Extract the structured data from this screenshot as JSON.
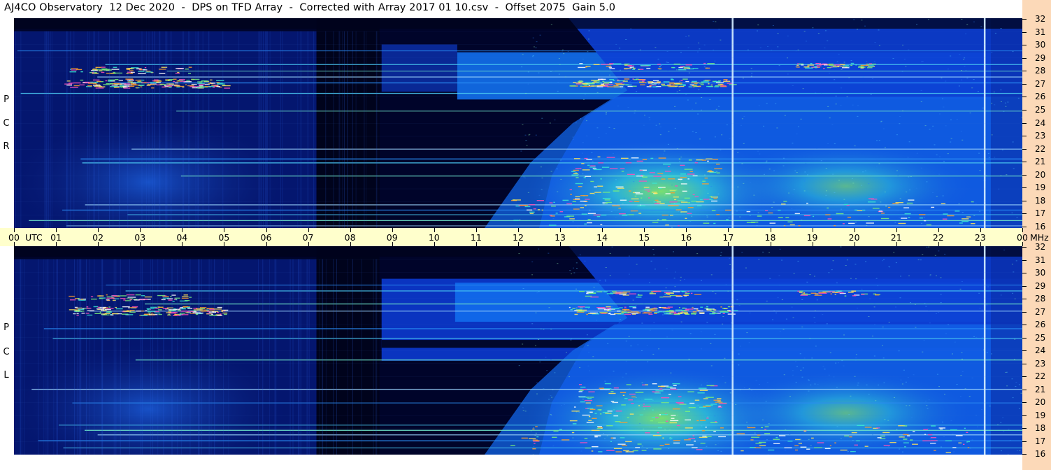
{
  "title": "AJ4CO Observatory  12 Dec 2020  -  DPS on TFD Array  -  Corrected with Array 2017 01 10.csv  -  Offset 2075  Gain 5.0",
  "panels": [
    {
      "id": "rcp",
      "label_letters": [
        "P",
        "C",
        "R"
      ]
    },
    {
      "id": "lcp",
      "label_letters": [
        "P",
        "C",
        "L"
      ]
    }
  ],
  "time_axis": {
    "labels": [
      "00",
      "01",
      "02",
      "03",
      "04",
      "05",
      "06",
      "07",
      "08",
      "09",
      "10",
      "11",
      "12",
      "13",
      "14",
      "15",
      "16",
      "17",
      "18",
      "19",
      "20",
      "21",
      "22",
      "23",
      "00"
    ],
    "unit_left": "UTC",
    "unit_right": "MHz"
  },
  "freq_axis": {
    "labels": [
      "32",
      "31",
      "30",
      "29",
      "28",
      "27",
      "26",
      "25",
      "24",
      "23",
      "22",
      "21",
      "20",
      "19",
      "18",
      "17",
      "16"
    ]
  },
  "colors": {
    "background": "#00042a",
    "axis_band": "#ffffcc",
    "freq_band": "#fcd9b8",
    "marker_line": "#cfe9ff"
  },
  "chart_data": {
    "type": "heatmap",
    "title": "AJ4CO Observatory  12 Dec 2020  -  DPS on TFD Array  -  Corrected with Array 2017 01 10.csv  -  Offset 2075  Gain 5.0",
    "xlabel": "UTC",
    "ylabel": "MHz",
    "xlim": [
      0,
      24
    ],
    "ylim": [
      16,
      32
    ],
    "series": [
      {
        "name": "RCP",
        "marker_lines_utc": [
          17.1,
          23.1
        ]
      },
      {
        "name": "LCP",
        "marker_lines_utc": [
          17.1,
          23.1
        ]
      }
    ]
  }
}
